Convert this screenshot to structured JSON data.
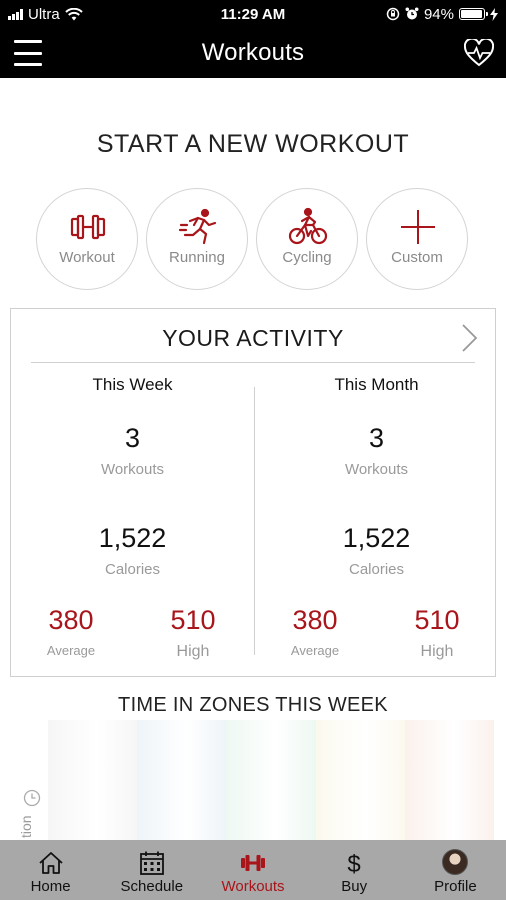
{
  "status_bar": {
    "carrier": "Ultra",
    "time": "11:29 AM",
    "battery_percent": "94%",
    "battery_level": 0.94
  },
  "header": {
    "title": "Workouts",
    "menu_icon": "hamburger-icon",
    "right_icon": "heart-pulse-icon"
  },
  "start_workout": {
    "title": "START A NEW WORKOUT",
    "buttons": [
      {
        "label": "Workout",
        "icon": "dumbbell-icon"
      },
      {
        "label": "Running",
        "icon": "runner-icon"
      },
      {
        "label": "Cycling",
        "icon": "cyclist-icon"
      },
      {
        "label": "Custom",
        "icon": "plus-icon"
      }
    ]
  },
  "activity": {
    "title": "YOUR ACTIVITY",
    "week": {
      "title": "This Week",
      "workouts": "3",
      "workouts_label": "Workouts",
      "calories": "1,522",
      "calories_label": "Calories",
      "average": "380",
      "average_label": "Average",
      "high": "510",
      "high_label": "High"
    },
    "month": {
      "title": "This Month",
      "workouts": "3",
      "workouts_label": "Workouts",
      "calories": "1,522",
      "calories_label": "Calories",
      "average": "380",
      "average_label": "Average",
      "high": "510",
      "high_label": "High"
    }
  },
  "zones": {
    "title": "TIME IN ZONES THIS WEEK",
    "axis_label_partial": "tion",
    "zone_colors": [
      "#f6f6f6",
      "#eef4f8",
      "#eef8f2",
      "#fbf9ee",
      "#fbf1ec"
    ]
  },
  "tabs": [
    {
      "label": "Home",
      "icon": "home-icon"
    },
    {
      "label": "Schedule",
      "icon": "calendar-icon"
    },
    {
      "label": "Workouts",
      "icon": "dumbbell-icon",
      "active": true
    },
    {
      "label": "Buy",
      "icon": "dollar-icon"
    },
    {
      "label": "Profile",
      "icon": "avatar"
    }
  ],
  "colors": {
    "accent": "#a8151a",
    "header_bg": "#000000",
    "tabbar_bg": "#a8a8a8"
  }
}
